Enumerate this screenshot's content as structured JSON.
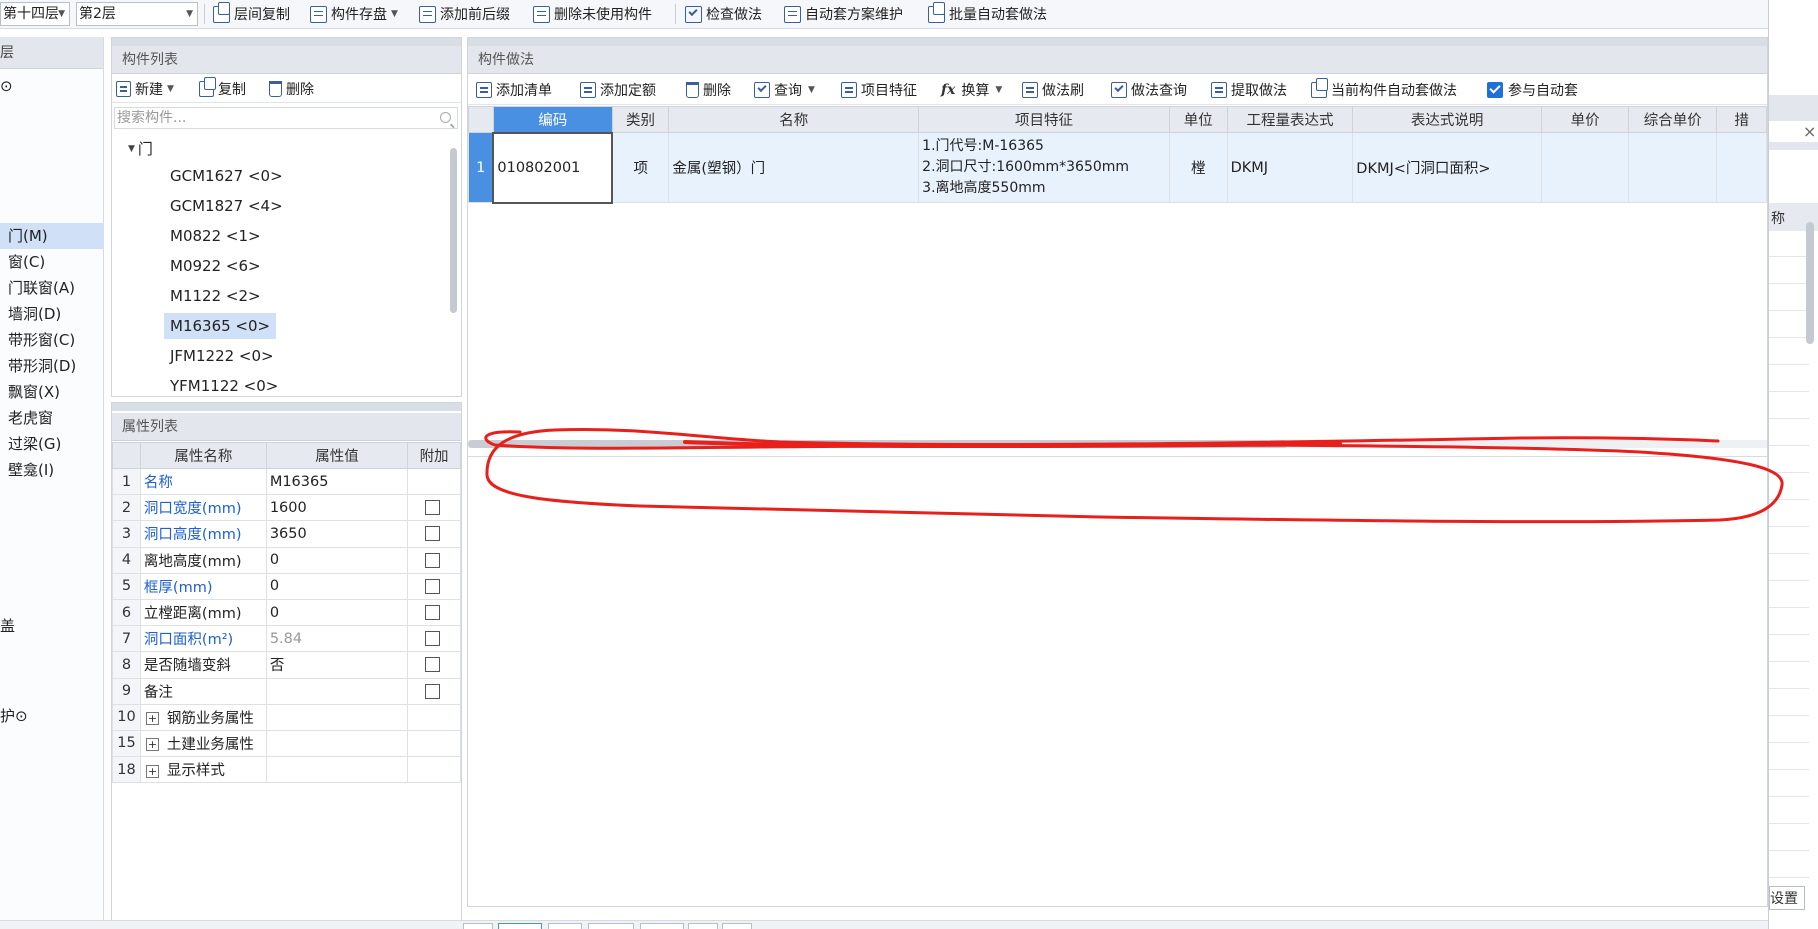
{
  "toolbar": {
    "floor_group": "第十四层",
    "floor": "第2层",
    "buttons": [
      "层间复制",
      "构件存盘",
      "添加前后缀",
      "删除未使用构件",
      "检查做法",
      "自动套方案维护",
      "批量自动套做法"
    ]
  },
  "left_nav": {
    "header": "层",
    "top_icon_text": "⊙",
    "items": [
      "门(M)",
      "窗(C)",
      "门联窗(A)",
      "墙洞(D)",
      "带形窗(C)",
      "带形洞(D)",
      "飘窗(X)",
      "老虎窗",
      "过梁(G)",
      "壁龛(I)"
    ],
    "active_index": 0,
    "lower_items": [
      "盖",
      "护⊙"
    ]
  },
  "component_list": {
    "title": "构件列表",
    "new_label": "新建",
    "copy_label": "复制",
    "delete_label": "删除",
    "search_placeholder": "搜索构件...",
    "root": "门",
    "items": [
      "GCM1627 <0>",
      "GCM1827 <4>",
      "M0822 <1>",
      "M0922 <6>",
      "M1122 <2>",
      "M16365 <0>",
      "JFM1222 <0>",
      "YFM1122 <0>"
    ],
    "selected_index": 5
  },
  "property_list": {
    "title": "属性列表",
    "headers": [
      "属性名称",
      "属性值",
      "附加"
    ],
    "rows": [
      {
        "num": "1",
        "name": "名称",
        "value": "M16365",
        "blue": true,
        "check": false
      },
      {
        "num": "2",
        "name": "洞口宽度(mm)",
        "value": "1600",
        "blue": true,
        "check": true
      },
      {
        "num": "3",
        "name": "洞口高度(mm)",
        "value": "3650",
        "blue": true,
        "check": true
      },
      {
        "num": "4",
        "name": "离地高度(mm)",
        "value": "0",
        "blue": false,
        "check": true
      },
      {
        "num": "5",
        "name": "框厚(mm)",
        "value": "0",
        "blue": true,
        "check": true
      },
      {
        "num": "6",
        "name": "立樘距离(mm)",
        "value": "0",
        "blue": false,
        "check": true
      },
      {
        "num": "7",
        "name": "洞口面积(m²)",
        "value": "5.84",
        "blue": true,
        "check": true,
        "gray_value": true
      },
      {
        "num": "8",
        "name": "是否随墙变斜",
        "value": "否",
        "blue": false,
        "check": true
      },
      {
        "num": "9",
        "name": "备注",
        "value": "",
        "blue": false,
        "check": true
      }
    ],
    "groups": [
      {
        "num": "10",
        "name": "钢筋业务属性"
      },
      {
        "num": "15",
        "name": "土建业务属性"
      },
      {
        "num": "18",
        "name": "显示样式"
      }
    ]
  },
  "method_panel": {
    "title": "构件做法",
    "buttons": [
      "添加清单",
      "添加定额",
      "删除",
      "查询",
      "项目特征",
      "换算",
      "做法刷",
      "做法查询",
      "提取做法",
      "当前构件自动套做法",
      "参与自动套"
    ],
    "fx_symbol": "fx",
    "auto_checked": true,
    "headers": [
      "编码",
      "类别",
      "名称",
      "项目特征",
      "单位",
      "工程量表达式",
      "表达式说明",
      "单价",
      "综合单价",
      "措"
    ],
    "row": {
      "num": "1",
      "code": "010802001",
      "type": "项",
      "name": "金属(塑钢）门",
      "features": [
        "1.门代号:M-16365",
        "2.洞口尺寸:1600mm*3650mm",
        "3.离地高度550mm"
      ],
      "unit": "樘",
      "expr": "DKMJ",
      "expr_desc": "DKMJ<门洞口面积>",
      "price": "",
      "comp_price": ""
    }
  },
  "right_panel": {
    "close": "×",
    "col_label": "称",
    "settings": "设置"
  },
  "colors": {
    "accent": "#4a90e2",
    "selection": "#cfe0f7",
    "annotation": "#e8201c",
    "blue_text": "#1e5fd1"
  }
}
